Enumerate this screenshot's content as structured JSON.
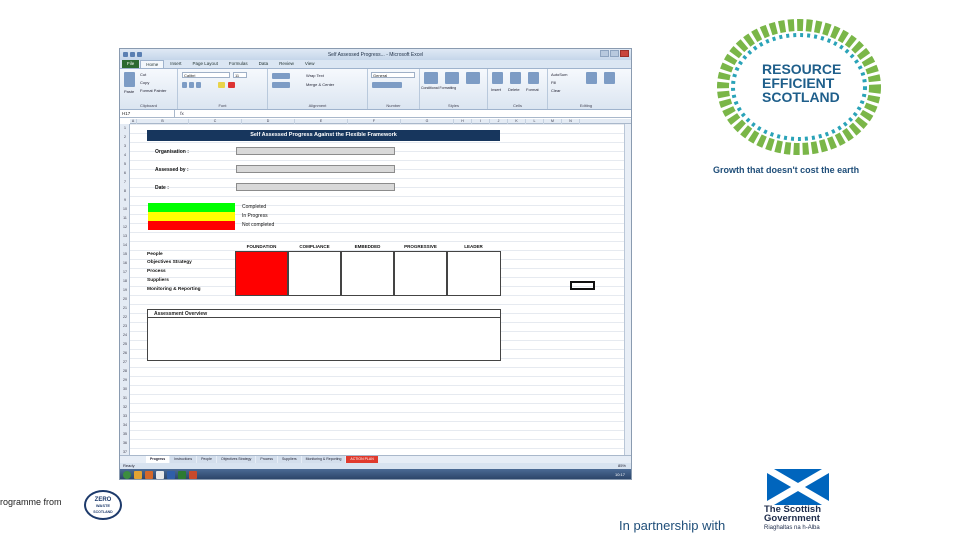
{
  "excel": {
    "title": "Self Assessed Progress... - Microsoft Excel",
    "ribbon_tabs": [
      "File",
      "Home",
      "Insert",
      "Page Layout",
      "Formulas",
      "Data",
      "Review",
      "View"
    ],
    "ribbon": {
      "clipboard": {
        "label": "Clipboard",
        "paste": "Paste",
        "cut": "Cut",
        "copy": "Copy",
        "format_painter": "Format Painter"
      },
      "font": {
        "label": "Font",
        "font_name": "Calibri",
        "font_size": "11"
      },
      "alignment": {
        "label": "Alignment",
        "wrap_text": "Wrap Text",
        "merge": "Merge & Center"
      },
      "number": {
        "label": "Number",
        "format": "General"
      },
      "styles": {
        "label": "Styles",
        "conditional": "Conditional Formatting",
        "format_table": "Format as Table",
        "cell_styles": "Cell Styles"
      },
      "cells": {
        "label": "Cells",
        "insert": "Insert",
        "delete": "Delete",
        "format": "Format"
      },
      "editing": {
        "label": "Editing",
        "autosum": "AutoSum",
        "fill": "Fill",
        "clear": "Clear",
        "sort": "Sort & Filter",
        "find": "Find & Select"
      }
    },
    "name_box": "H17",
    "fx": "fx",
    "columns": [
      "A",
      "B",
      "C",
      "D",
      "E",
      "F",
      "G",
      "H",
      "I",
      "J",
      "K",
      "L",
      "M",
      "N"
    ],
    "rows": [
      "1",
      "2",
      "3",
      "4",
      "5",
      "6",
      "7",
      "8",
      "9",
      "10",
      "11",
      "12",
      "13",
      "14",
      "15",
      "16",
      "17",
      "18",
      "19",
      "20",
      "21",
      "22",
      "23",
      "24",
      "25",
      "26",
      "27",
      "28",
      "29",
      "30",
      "31",
      "32",
      "33",
      "34",
      "35",
      "36",
      "37"
    ],
    "sheet": {
      "banner": "Self Assessed Progress Against the Flexible Framework",
      "organisation_label": "Organisation :",
      "assessed_by_label": "Assessed by :",
      "date_label": "Date :",
      "legend": [
        {
          "label": "Completed",
          "color": "#00ff00"
        },
        {
          "label": "In Progress",
          "color": "#ffff00"
        },
        {
          "label": "Not completed",
          "color": "#ff0000"
        }
      ],
      "levels": [
        "FOUNDATION",
        "COMPLIANCE",
        "EMBEDDED",
        "PROGRESSIVE",
        "LEADER"
      ],
      "themes": [
        "People",
        "Objectives Strategy",
        "Process",
        "Suppliers",
        "Monitoring & Reporting"
      ],
      "assessment_overview": "Assessment Overview"
    },
    "sheet_tabs": [
      "Progress",
      "Instructions",
      "People",
      "Objectives Strategy",
      "Process",
      "Suppliers",
      "Monitoring & Reporting",
      "ACTION PLAN"
    ],
    "status": "Ready",
    "zoom": "85%",
    "clock": "10:17"
  },
  "branding": {
    "res_logo_lines": [
      "RESOURCE",
      "EFFICIENT",
      "SCOTLAND"
    ],
    "tagline": "Growth that doesn't cost the earth",
    "programme_from": "rogramme from",
    "zero_waste_logo": [
      "ZERO",
      "WASTE",
      "SCOTLAND"
    ],
    "partnership": "In partnership with",
    "gov_name": "The Scottish Government",
    "gov_gaelic": "Riaghaltas na h-Alba"
  },
  "colors": {
    "banner": "#17365d",
    "accent_green": "#7ab648",
    "brand_blue": "#1f4e79",
    "saltire_blue": "#0065bd"
  }
}
